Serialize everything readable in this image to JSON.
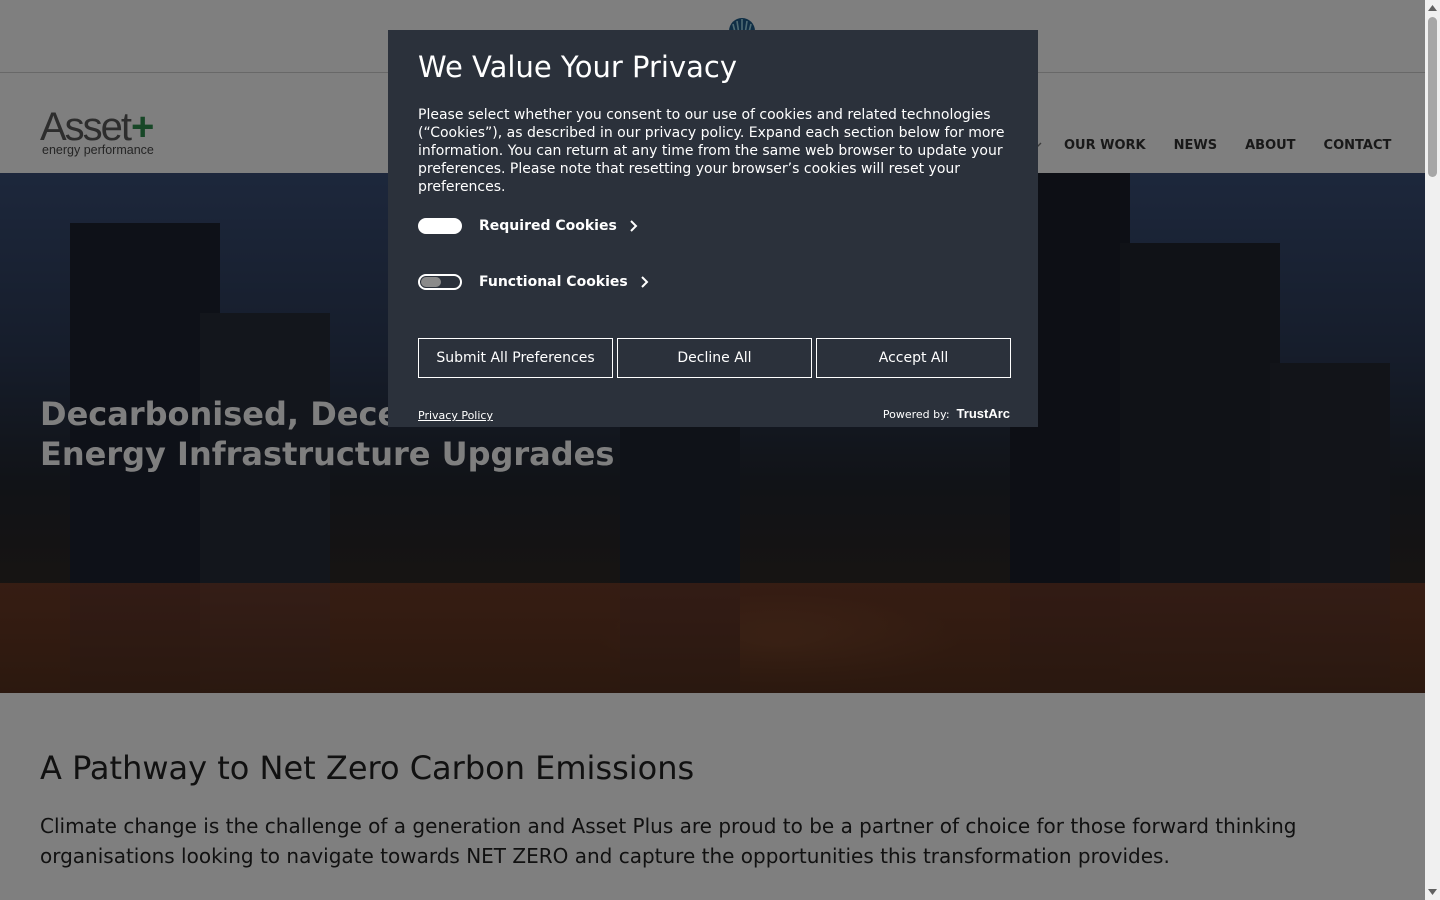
{
  "header": {
    "brand_word": "Asset",
    "brand_plus": "+",
    "brand_tagline": "energy performance",
    "nav": [
      {
        "label": "OUR WORK"
      },
      {
        "label": "NEWS"
      },
      {
        "label": "ABOUT"
      },
      {
        "label": "CONTACT"
      }
    ]
  },
  "hero": {
    "title_line1": "Decarbonised, Decent",
    "title_line2": "Energy Infrastructure Upgrades"
  },
  "content": {
    "title": "A Pathway to Net Zero Carbon Emissions",
    "body": "Climate change is the challenge of a generation and Asset Plus are proud to be a partner of choice for those forward thinking organisations looking to navigate towards NET ZERO and capture the opportunities this transformation provides."
  },
  "consent": {
    "title": "We Value Your Privacy",
    "description": "Please select whether you consent to our use of cookies and related technologies (“Cookies”), as described in our privacy policy. Expand each section below for more information. You can return at any time from the same web browser to update your preferences. Please note that resetting your browser’s cookies will reset your preferences.",
    "categories": [
      {
        "label": "Required Cookies",
        "state": "on"
      },
      {
        "label": "Functional Cookies",
        "state": "off"
      }
    ],
    "buttons": {
      "submit": "Submit All Preferences",
      "decline": "Decline All",
      "accept": "Accept All"
    },
    "privacy_link": "Privacy Policy",
    "powered_by_label": "Powered by:",
    "powered_by_brand": "TrustArc"
  },
  "colors": {
    "modal_bg": "#2b313b",
    "overlay": "rgba(0,0,0,0.5)",
    "brand_green": "#2f8f4e",
    "brand_gray": "#5b5b5b"
  },
  "icons": [
    "globe-logo-icon",
    "chevron-down-icon",
    "chevron-right-icon",
    "scroll-up-arrow-icon",
    "scroll-down-arrow-icon"
  ]
}
